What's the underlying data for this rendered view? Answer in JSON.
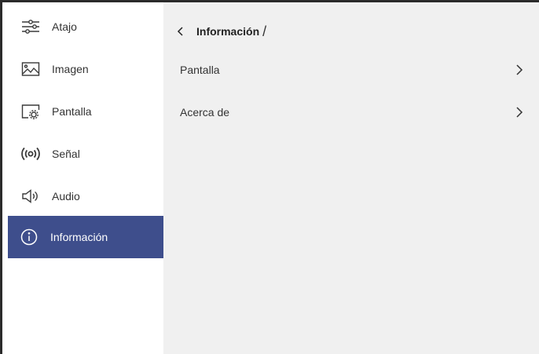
{
  "sidebar": {
    "items": [
      {
        "label": "Atajo",
        "icon": "sliders-icon"
      },
      {
        "label": "Imagen",
        "icon": "image-icon"
      },
      {
        "label": "Pantalla",
        "icon": "screen-settings-icon"
      },
      {
        "label": "Señal",
        "icon": "signal-icon"
      },
      {
        "label": "Audio",
        "icon": "speaker-icon"
      },
      {
        "label": "Información",
        "icon": "info-icon"
      }
    ],
    "active_index": 5
  },
  "main": {
    "breadcrumb": {
      "title": "Información",
      "separator": "/"
    },
    "rows": [
      {
        "label": "Pantalla"
      },
      {
        "label": "Acerca de"
      }
    ]
  },
  "colors": {
    "accent": "#3e4e8c",
    "panel_bg": "#f0f0f0",
    "sidebar_bg": "#ffffff"
  }
}
